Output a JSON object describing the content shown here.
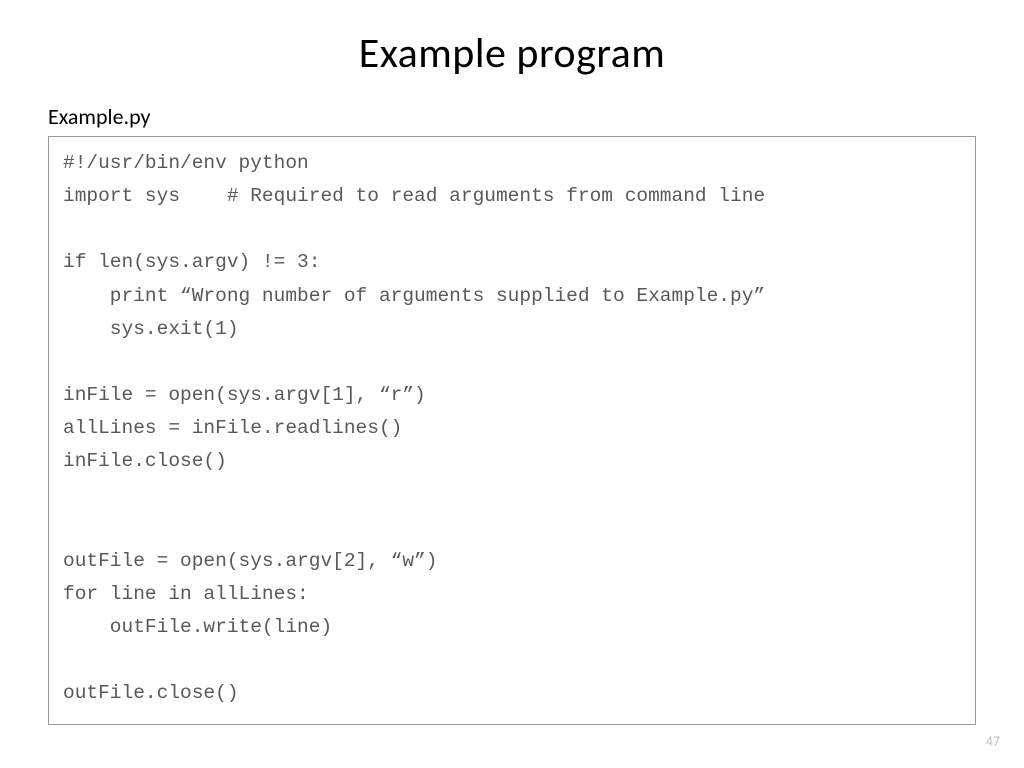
{
  "title": "Example program",
  "filename": "Example.py",
  "code": "#!/usr/bin/env python\nimport sys    # Required to read arguments from command line\n\nif len(sys.argv) != 3:\n    print “Wrong number of arguments supplied to Example.py”\n    sys.exit(1)\n\ninFile = open(sys.argv[1], “r”)\nallLines = inFile.readlines()\ninFile.close()\n\n\noutFile = open(sys.argv[2], “w”)\nfor line in allLines:\n    outFile.write(line)\n\noutFile.close()",
  "page_number": "47"
}
